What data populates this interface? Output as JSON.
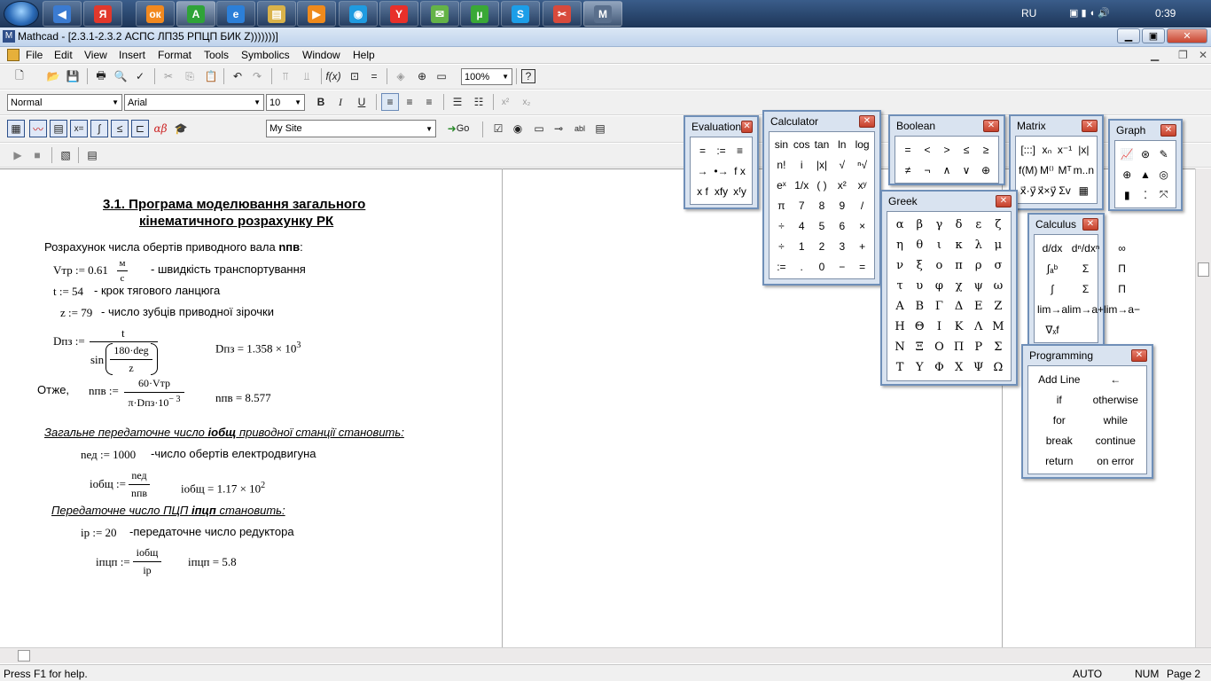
{
  "taskbar": {
    "apps": [
      {
        "icon": "speaker-app-icon",
        "glyph": "◀",
        "color": "#3b7bd1"
      },
      {
        "icon": "yandex-icon",
        "glyph": "Я",
        "color": "#e2382c"
      },
      {
        "icon": "odnoklassniki-icon",
        "glyph": "ок",
        "color": "#f2891f"
      },
      {
        "icon": "green-a-app-icon",
        "glyph": "A",
        "color": "#2fa338"
      },
      {
        "icon": "internet-explorer-icon",
        "glyph": "e",
        "color": "#2c7fd8"
      },
      {
        "icon": "file-explorer-icon",
        "glyph": "▤",
        "color": "#d9b24a"
      },
      {
        "icon": "media-player-icon",
        "glyph": "▶",
        "color": "#ef8a1c"
      },
      {
        "icon": "bird-app-icon",
        "glyph": "◉",
        "color": "#1f9be0"
      },
      {
        "icon": "yandex-browser-icon",
        "glyph": "Y",
        "color": "#e8302a"
      },
      {
        "icon": "chat-app-icon",
        "glyph": "✉",
        "color": "#64b347"
      },
      {
        "icon": "utorrent-icon",
        "glyph": "µ",
        "color": "#3aa836"
      },
      {
        "icon": "skype-icon",
        "glyph": "S",
        "color": "#1c9ee8"
      },
      {
        "icon": "snipping-tool-icon",
        "glyph": "✂",
        "color": "#d84a3c"
      },
      {
        "icon": "mathcad-taskbar-icon",
        "glyph": "M",
        "color": "#5a6f8c"
      }
    ],
    "language": "RU",
    "clock": "0:39"
  },
  "window": {
    "title": "Mathcad - [2.3.1-2.3.2    АСПС ЛП35 РПЦП БИК Z)))))))]"
  },
  "menu": [
    "File",
    "Edit",
    "View",
    "Insert",
    "Format",
    "Tools",
    "Symbolics",
    "Window",
    "Help"
  ],
  "format_bar": {
    "style": "Normal",
    "font": "Arial",
    "size": "10",
    "bold": "B",
    "italic": "I",
    "underline": "U"
  },
  "standard_bar": {
    "zoom": "100%"
  },
  "math_bar": {
    "resource": "My Site",
    "go": "Go"
  },
  "document": {
    "title_line1": "3.1. Програма моделювання загального",
    "title_line2": "кінематичного розрахунку РК",
    "intro_text": "Розрахунок числа обертів приводного вала",
    "intro_var": "nпв",
    "intro_colon": ":",
    "vtr_def": "Vтр := 0.61",
    "vtr_unit_num": "м",
    "vtr_unit_den": "с",
    "vtr_note": "- швидкість транспортування",
    "t_def": "t := 54",
    "t_note": "- крок тягового ланцюга",
    "z_def": "z := 79",
    "z_note": "- число зубців приводної зірочки",
    "dpz_lhs": "Dпз :=",
    "dpz_num": "t",
    "dpz_sin": "sin",
    "dpz_inner_num": "180·deg",
    "dpz_inner_den": "z",
    "dpz_result": "Dпз = 1.358 × 10",
    "dpz_exp": "3",
    "otzhe": "Отже,",
    "npv_lhs": "nпв :=",
    "npv_num": "60·Vтр",
    "npv_den": "π·Dпз·10",
    "npv_den_exp": "− 3",
    "npv_result": "nпв = 8.577",
    "heading2_pre": "Загальне передаточне число",
    "heading2_var": "iобщ",
    "heading2_post": "приводної станції становить:",
    "ned_def": "nед := 1000",
    "ned_note": "-число обертів електродвигуна",
    "iobsh_lhs": "iобщ :=",
    "iobsh_num": "nед",
    "iobsh_den": "nпв",
    "iobsh_result": "iобщ = 1.17 × 10",
    "iobsh_exp": "2",
    "heading3_pre": "Передаточне число ПЦП",
    "heading3_var": "iпцп",
    "heading3_post": "становить:",
    "ir_def": "iр := 20",
    "ir_note": "-передаточне число редуктора",
    "ipcp_lhs": "iпцп :=",
    "ipcp_num": "iобщ",
    "ipcp_den": "iр",
    "ipcp_result": "iпцп = 5.8"
  },
  "palettes": {
    "evaluation": {
      "title": "Evaluation",
      "cells": [
        "=",
        ":=",
        "≡",
        "→",
        "•→",
        "f x",
        "x f",
        "xfy",
        "xᶠy"
      ]
    },
    "calculator": {
      "title": "Calculator",
      "cells": [
        "sin",
        "cos",
        "tan",
        "ln",
        "log",
        "n!",
        "i",
        "|x|",
        "√",
        "ⁿ√",
        "eˣ",
        "1/x",
        "( )",
        "x²",
        "xʸ",
        "π",
        "7",
        "8",
        "9",
        "/",
        "÷",
        "4",
        "5",
        "6",
        "×",
        "÷",
        "1",
        "2",
        "3",
        "+",
        ":=",
        ".",
        "0",
        "−",
        "="
      ]
    },
    "boolean": {
      "title": "Boolean",
      "cells": [
        "=",
        "<",
        ">",
        "≤",
        "≥",
        "≠",
        "¬",
        "∧",
        "∨",
        "⊕"
      ]
    },
    "matrix": {
      "title": "Matrix",
      "cells": [
        "[:::]",
        "xₙ",
        "x⁻¹",
        "|x|",
        "f(M)",
        "M⁽⁾",
        "Mᵀ",
        "m..n",
        "x⃗·y⃗",
        "x⃗×y⃗",
        "Σv",
        "▦"
      ]
    },
    "graph": {
      "title": "Graph",
      "cells": [
        "📈",
        "⊛",
        "✎",
        "⊕",
        "▲",
        "◎",
        "▮",
        "⁚",
        "⤧"
      ]
    },
    "greek": {
      "title": "Greek",
      "cells": [
        "α",
        "β",
        "γ",
        "δ",
        "ε",
        "ζ",
        "η",
        "θ",
        "ι",
        "κ",
        "λ",
        "μ",
        "ν",
        "ξ",
        "ο",
        "π",
        "ρ",
        "σ",
        "τ",
        "υ",
        "φ",
        "χ",
        "ψ",
        "ω",
        "Α",
        "Β",
        "Γ",
        "Δ",
        "Ε",
        "Ζ",
        "Η",
        "Θ",
        "Ι",
        "Κ",
        "Λ",
        "Μ",
        "Ν",
        "Ξ",
        "Ο",
        "Π",
        "Ρ",
        "Σ",
        "Τ",
        "Υ",
        "Φ",
        "Χ",
        "Ψ",
        "Ω"
      ]
    },
    "calculus": {
      "title": "Calculus",
      "cells": [
        "d/dx",
        "dⁿ/dxⁿ",
        "∞",
        "∫ₐᵇ",
        "Σ",
        "Π",
        "∫",
        "Σ",
        "Π",
        "lim→a",
        "lim→a+",
        "lim→a−",
        "∇ₓf"
      ]
    },
    "programming": {
      "title": "Programming",
      "cells": [
        "Add Line",
        "←",
        "if",
        "otherwise",
        "for",
        "while",
        "break",
        "continue",
        "return",
        "on error"
      ]
    }
  },
  "status": {
    "help": "Press F1 for help.",
    "mode": "AUTO",
    "num": "NUM",
    "page": "Page 2"
  }
}
